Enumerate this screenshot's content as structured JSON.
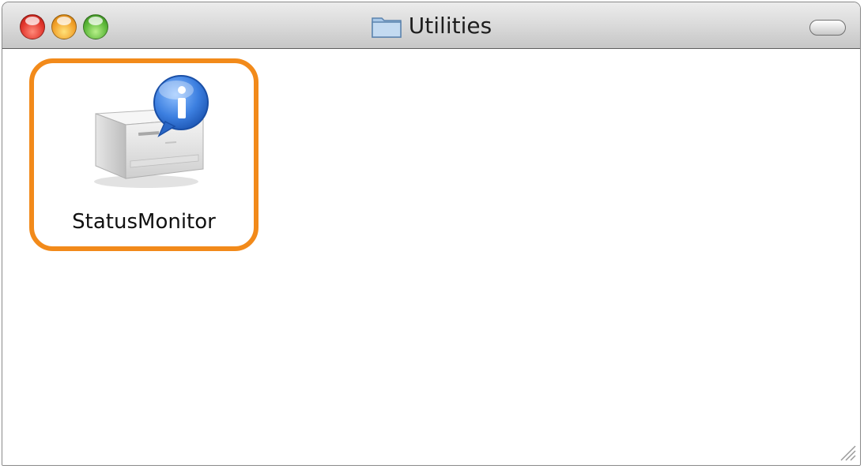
{
  "window": {
    "title": "Utilities",
    "title_icon": "folder-icon"
  },
  "items": [
    {
      "label": "StatusMonitor",
      "icon": "printer-info-icon",
      "selected": true
    }
  ],
  "colors": {
    "highlight_border": "#f28a1a",
    "close_button": "#e2362d",
    "minimize_button": "#f2a12b",
    "zoom_button": "#5db83a"
  }
}
